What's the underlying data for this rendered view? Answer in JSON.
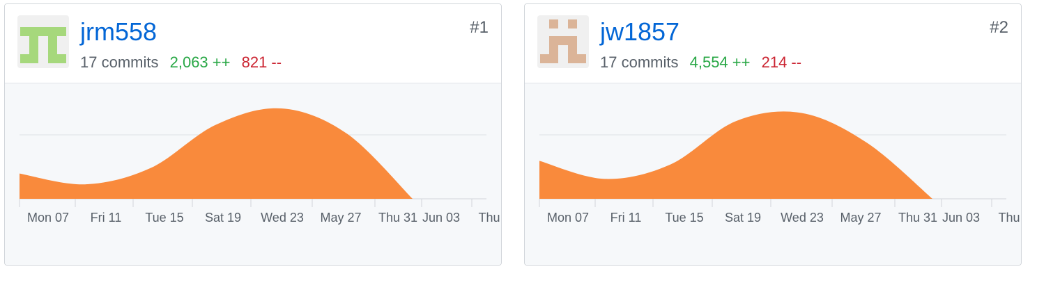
{
  "contributors": [
    {
      "name": "jrm558",
      "commits": "17 commits",
      "additions": "2,063 ++",
      "deletions": "821 --",
      "rank": "#1",
      "avatar_color": "#a6d87c",
      "chart_data": {
        "type": "area",
        "x": [
          "Mon 07",
          "Fri 11",
          "Tue 15",
          "Sat 19",
          "Wed 23",
          "May 27",
          "Thu 31",
          "Jun 03",
          "Thu"
        ],
        "values": [
          0.28,
          0.16,
          0.34,
          0.82,
          1.0,
          0.72,
          0.0
        ],
        "color": "#f98a3c",
        "grid": true
      }
    },
    {
      "name": "jw1857",
      "commits": "17 commits",
      "additions": "4,554 ++",
      "deletions": "214 --",
      "rank": "#2",
      "avatar_color": "#dbb498",
      "chart_data": {
        "type": "area",
        "x": [
          "Mon 07",
          "Fri 11",
          "Tue 15",
          "Sat 19",
          "Wed 23",
          "May 27",
          "Thu 31",
          "Jun 03",
          "Thu"
        ],
        "values": [
          0.42,
          0.22,
          0.38,
          0.86,
          0.95,
          0.62,
          0.0
        ],
        "color": "#f98a3c",
        "grid": true
      }
    }
  ]
}
